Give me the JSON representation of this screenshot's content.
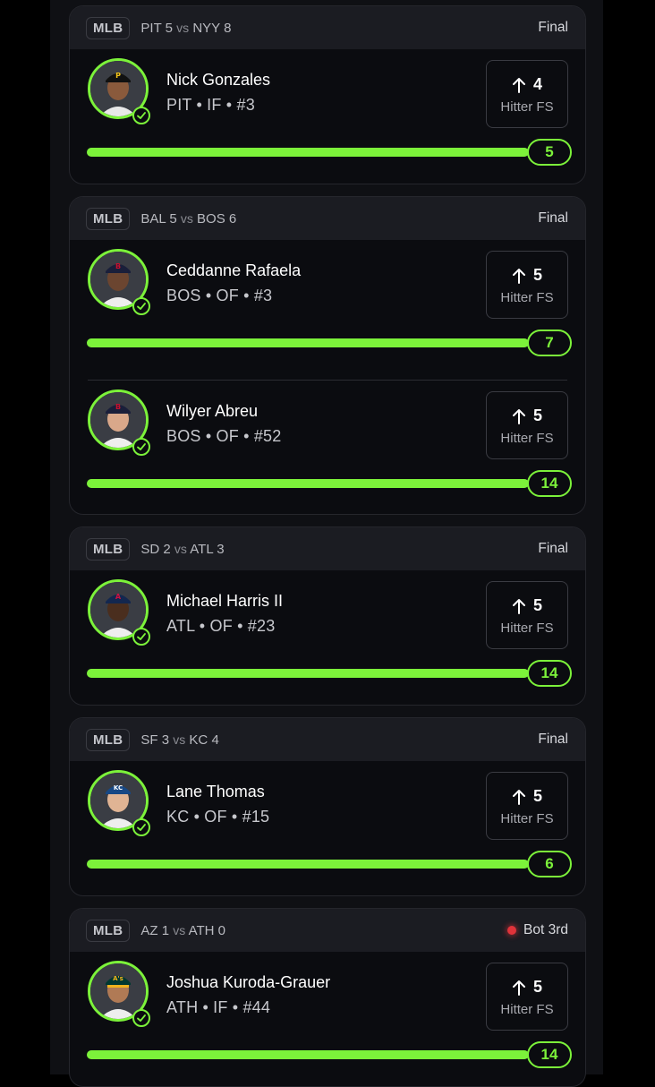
{
  "colors": {
    "accent": "#7cf23a",
    "live": "#e0333a",
    "card_bg": "#0b0c10",
    "header_bg": "#1b1c22"
  },
  "games": [
    {
      "league": "MLB",
      "away": "PIT",
      "away_score": "5",
      "vs": "vs",
      "home": "NYY",
      "home_score": "8",
      "status": "Final",
      "live": false,
      "players": [
        {
          "name": "Nick Gonzales",
          "info": "PIT • IF • #3",
          "fs_value": "4",
          "fs_label": "Hitter FS",
          "progress_value": "5",
          "progress": 1.0
        }
      ]
    },
    {
      "league": "MLB",
      "away": "BAL",
      "away_score": "5",
      "vs": "vs",
      "home": "BOS",
      "home_score": "6",
      "status": "Final",
      "live": false,
      "players": [
        {
          "name": "Ceddanne Rafaela",
          "info": "BOS • OF • #3",
          "fs_value": "5",
          "fs_label": "Hitter FS",
          "progress_value": "7",
          "progress": 1.0
        },
        {
          "name": "Wilyer Abreu",
          "info": "BOS • OF • #52",
          "fs_value": "5",
          "fs_label": "Hitter FS",
          "progress_value": "14",
          "progress": 1.0
        }
      ]
    },
    {
      "league": "MLB",
      "away": "SD",
      "away_score": "2",
      "vs": "vs",
      "home": "ATL",
      "home_score": "3",
      "status": "Final",
      "live": false,
      "players": [
        {
          "name": "Michael Harris II",
          "info": "ATL • OF • #23",
          "fs_value": "5",
          "fs_label": "Hitter FS",
          "progress_value": "14",
          "progress": 1.0
        }
      ]
    },
    {
      "league": "MLB",
      "away": "SF",
      "away_score": "3",
      "vs": "vs",
      "home": "KC",
      "home_score": "4",
      "status": "Final",
      "live": false,
      "players": [
        {
          "name": "Lane Thomas",
          "info": "KC • OF • #15",
          "fs_value": "5",
          "fs_label": "Hitter FS",
          "progress_value": "6",
          "progress": 1.0
        }
      ]
    },
    {
      "league": "MLB",
      "away": "AZ",
      "away_score": "1",
      "vs": "vs",
      "home": "ATH",
      "home_score": "0",
      "status": "Bot 3rd",
      "live": true,
      "players": [
        {
          "name": "Joshua Kuroda-Grauer",
          "info": "ATH • IF • #44",
          "fs_value": "5",
          "fs_label": "Hitter FS",
          "progress_value": "14",
          "progress": 1.0
        }
      ]
    }
  ]
}
